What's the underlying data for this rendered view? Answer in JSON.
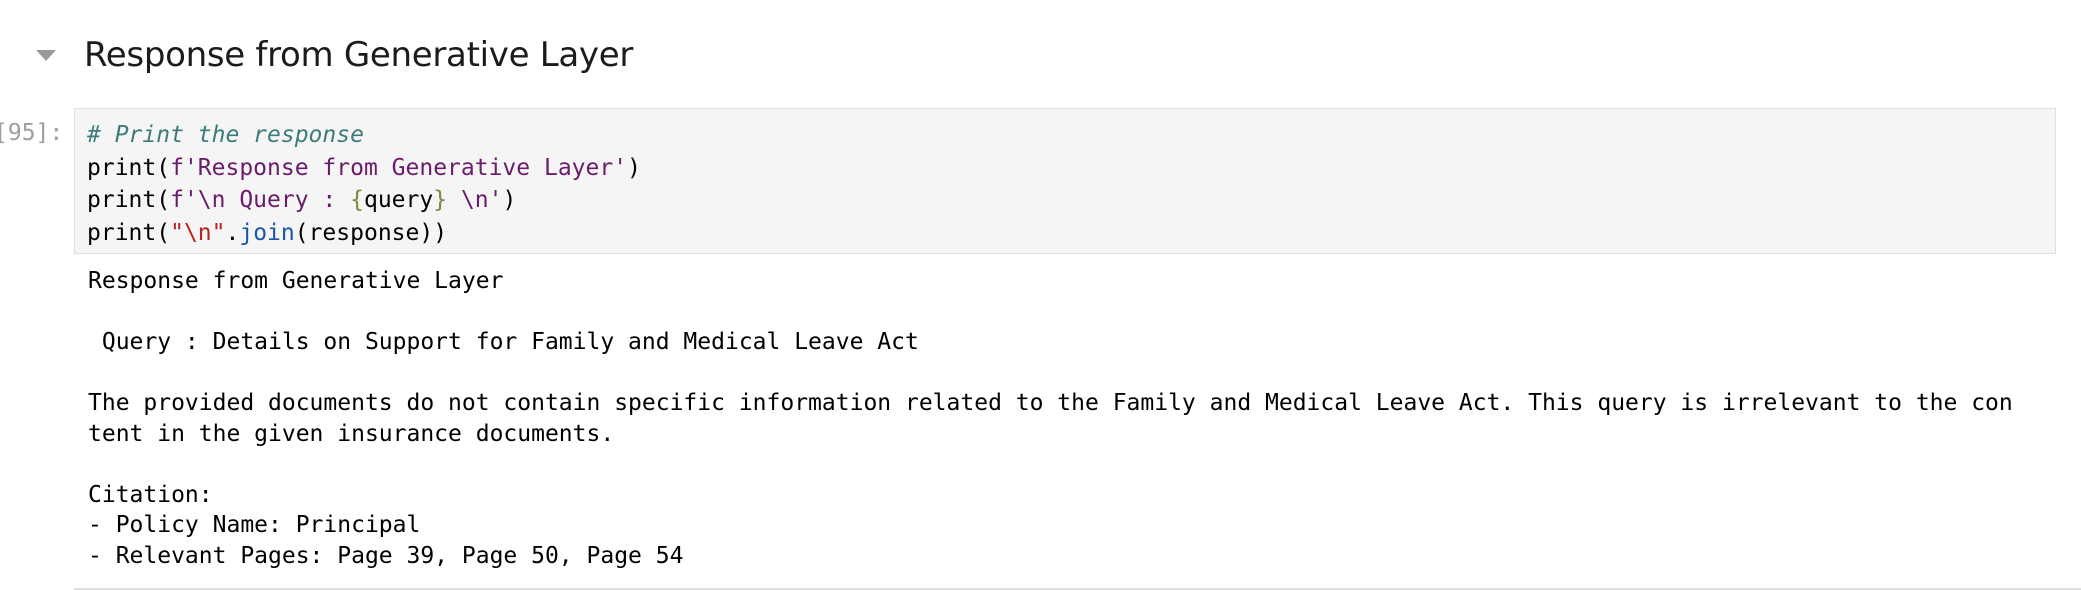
{
  "markdown_cell": {
    "heading": "Response from Generative Layer",
    "toggle_icon": "caret-down-icon"
  },
  "code_cell": {
    "prompt": "[95]:",
    "lines": [
      "# Print the response",
      "print(f'Response from Generative Layer')",
      "print(f'\\n Query : {query} \\n')",
      "print(\"\\n\".join(response))"
    ]
  },
  "output": {
    "lines": [
      "Response from Generative Layer",
      "",
      " Query : Details on Support for Family and Medical Leave Act",
      "",
      "The provided documents do not contain specific information related to the Family and Medical Leave Act. This query is irrelevant to the con",
      "tent in the given insurance documents.",
      "",
      "Citation:",
      "- Policy Name: Principal",
      "- Relevant Pages: Page 39, Page 50, Page 54"
    ]
  },
  "colors": {
    "comment": "#3d7a7a",
    "string": "#6a1b6a",
    "string_literal": "#ba2121",
    "attribute": "#1a56a8",
    "code_background": "#f5f5f5",
    "prompt": "#9e9e9e"
  }
}
